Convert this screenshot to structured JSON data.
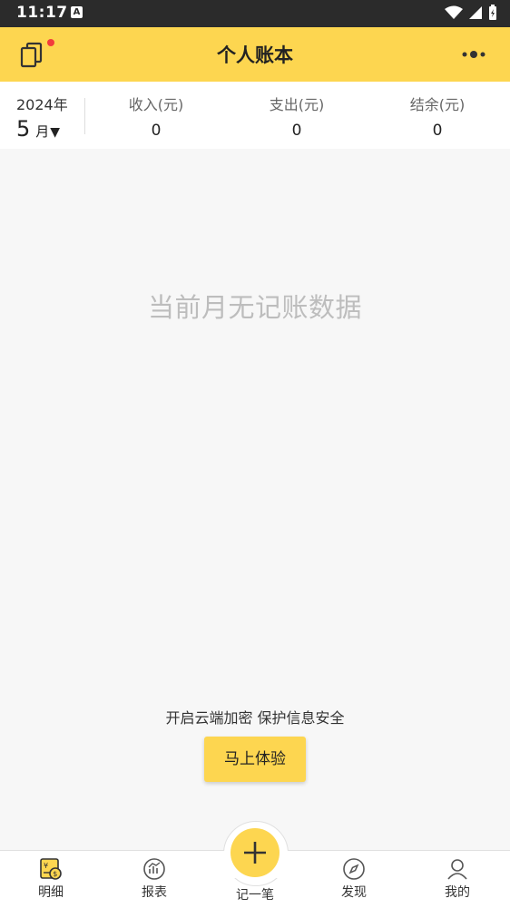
{
  "status_bar": {
    "time": "11:17",
    "notification_badge": "A"
  },
  "app_bar": {
    "title": "个人账本"
  },
  "summary": {
    "year": "2024年",
    "month": "5",
    "month_unit": "月",
    "month_caret": "▼",
    "income_label": "收入(元)",
    "income_value": "0",
    "expense_label": "支出(元)",
    "expense_value": "0",
    "balance_label": "结余(元)",
    "balance_value": "0"
  },
  "empty_state": {
    "message": "当前月无记账数据"
  },
  "cloud_promo": {
    "text": "开启云端加密 保护信息安全",
    "button_label": "马上体验"
  },
  "tab_bar": {
    "items": [
      {
        "label": "明细",
        "icon": "ledger-icon",
        "active": true
      },
      {
        "label": "报表",
        "icon": "chart-icon"
      },
      {
        "label": "记一笔",
        "icon": "plus-icon"
      },
      {
        "label": "发现",
        "icon": "compass-icon"
      },
      {
        "label": "我的",
        "icon": "person-icon"
      }
    ]
  },
  "colors": {
    "accent": "#fdd650",
    "status_bar": "#2b2b2b",
    "badge": "#f23c3c"
  }
}
